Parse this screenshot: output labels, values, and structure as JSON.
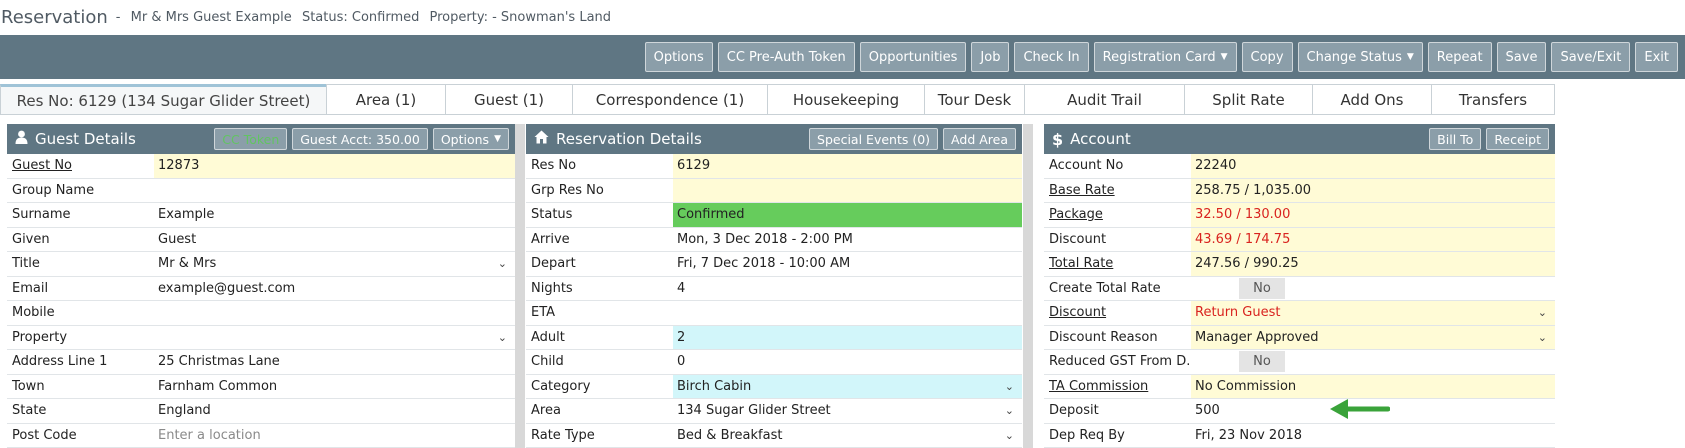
{
  "title": {
    "main": "Reservation",
    "dash": "-",
    "guest": "Mr & Mrs Guest Example",
    "status": "Status: Confirmed",
    "property": "Property: - Snowman's Land"
  },
  "toolbar": [
    {
      "name": "options-button",
      "label": "Options"
    },
    {
      "name": "cc-pre-auth-token-button",
      "label": "CC Pre-Auth Token"
    },
    {
      "name": "opportunities-button",
      "label": "Opportunities"
    },
    {
      "name": "job-button",
      "label": "Job"
    },
    {
      "name": "check-in-button",
      "label": "Check In"
    },
    {
      "name": "registration-card-button",
      "label": "Registration Card",
      "dropdown": true
    },
    {
      "name": "copy-button",
      "label": "Copy"
    },
    {
      "name": "change-status-button",
      "label": "Change Status",
      "dropdown": true
    },
    {
      "name": "repeat-button",
      "label": "Repeat"
    },
    {
      "name": "save-button",
      "label": "Save"
    },
    {
      "name": "save-exit-button",
      "label": "Save/Exit"
    },
    {
      "name": "exit-button",
      "label": "Exit"
    }
  ],
  "tabs": [
    {
      "label": "Res No: 6129 (134 Sugar Glider Street)",
      "active": true
    },
    {
      "label": "Area (1)"
    },
    {
      "label": "Guest (1)"
    },
    {
      "label": "Correspondence (1)"
    },
    {
      "label": "Housekeeping"
    },
    {
      "label": "Tour Desk"
    },
    {
      "label": "Audit Trail"
    },
    {
      "label": "Split Rate"
    },
    {
      "label": "Add Ons"
    },
    {
      "label": "Transfers"
    }
  ],
  "guest_panel": {
    "title": "Guest Details",
    "icon": "user-icon",
    "buttons": {
      "cc_token": "CC Token",
      "guest_acct": "Guest Acct: 350.00",
      "options": "Options"
    },
    "rows": [
      {
        "label": "Guest No",
        "value": "12873",
        "link": true,
        "style": "yellow"
      },
      {
        "label": "Group Name",
        "value": ""
      },
      {
        "label": "Surname",
        "value": "Example"
      },
      {
        "label": "Given",
        "value": "Guest"
      },
      {
        "label": "Title",
        "value": "Mr & Mrs",
        "select": true
      },
      {
        "label": "Email",
        "value": "example@guest.com"
      },
      {
        "label": "Mobile",
        "value": ""
      },
      {
        "label": "Property",
        "value": "",
        "select": true
      },
      {
        "label": "Address Line 1",
        "value": "25 Christmas Lane"
      },
      {
        "label": "Town",
        "value": "Farnham Common"
      },
      {
        "label": "State",
        "value": "England"
      },
      {
        "label": "Post Code",
        "value": "",
        "placeholder": "Enter a location"
      }
    ]
  },
  "reservation_panel": {
    "title": "Reservation Details",
    "icon": "home-icon",
    "buttons": {
      "special_events": "Special Events (0)",
      "add_area": "Add Area"
    },
    "rows": [
      {
        "label": "Res No",
        "value": "6129",
        "style": "yellow"
      },
      {
        "label": "Grp Res No",
        "value": "",
        "style": "yellow"
      },
      {
        "label": "Status",
        "value": "Confirmed",
        "style": "green"
      },
      {
        "label": "Arrive",
        "value": "Mon, 3 Dec 2018 - 2:00 PM"
      },
      {
        "label": "Depart",
        "value": "Fri, 7 Dec 2018 - 10:00 AM"
      },
      {
        "label": "Nights",
        "value": "4"
      },
      {
        "label": "ETA",
        "value": ""
      },
      {
        "label": "Adult",
        "value": "2",
        "style": "cyan"
      },
      {
        "label": "Child",
        "value": "0"
      },
      {
        "label": "Category",
        "value": "Birch Cabin",
        "style": "cyan",
        "select": true
      },
      {
        "label": "Area",
        "value": "134 Sugar Glider Street",
        "select": true
      },
      {
        "label": "Rate Type",
        "value": "Bed & Breakfast",
        "select": true
      }
    ]
  },
  "account_panel": {
    "title": "Account",
    "icon": "dollar-icon",
    "buttons": {
      "bill_to": "Bill To",
      "receipt": "Receipt"
    },
    "rows": [
      {
        "label": "Account No",
        "value": "22240",
        "style": "yellow"
      },
      {
        "label": "Base Rate",
        "value": "258.75 / 1,035.00",
        "link": true,
        "style": "yellow"
      },
      {
        "label": "Package",
        "value": "32.50 / 130.00",
        "link": true,
        "style": "yellow",
        "red": true
      },
      {
        "label": "Discount",
        "value": "43.69 / 174.75",
        "style": "yellow",
        "red": true
      },
      {
        "label": "Total Rate",
        "value": "247.56 / 990.25",
        "link": true,
        "style": "yellow"
      },
      {
        "label": "Create Total Rate",
        "value": "No",
        "toggle": true
      },
      {
        "label": "Discount",
        "value": "Return Guest",
        "link": true,
        "style": "yellow",
        "red": true,
        "select": true
      },
      {
        "label": "Discount Reason",
        "value": "Manager Approved",
        "style": "yellow",
        "select": true
      },
      {
        "label": "Reduced GST From D...",
        "value": "No",
        "toggle": true
      },
      {
        "label": "TA Commission",
        "value": "No Commission",
        "link": true,
        "style": "yellow"
      },
      {
        "label": "Deposit",
        "value": "500"
      },
      {
        "label": "Dep Req By",
        "value": "Fri, 23 Nov 2018"
      }
    ]
  },
  "colors": {
    "header_bg": "#5f7683",
    "button_bg": "#8b9ea9",
    "yellow_field": "#fffbd6",
    "green_status": "#66cc5c",
    "cyan_field": "#d2f6fa",
    "red_text": "#d9231f",
    "arrow": "#3aa33a"
  }
}
